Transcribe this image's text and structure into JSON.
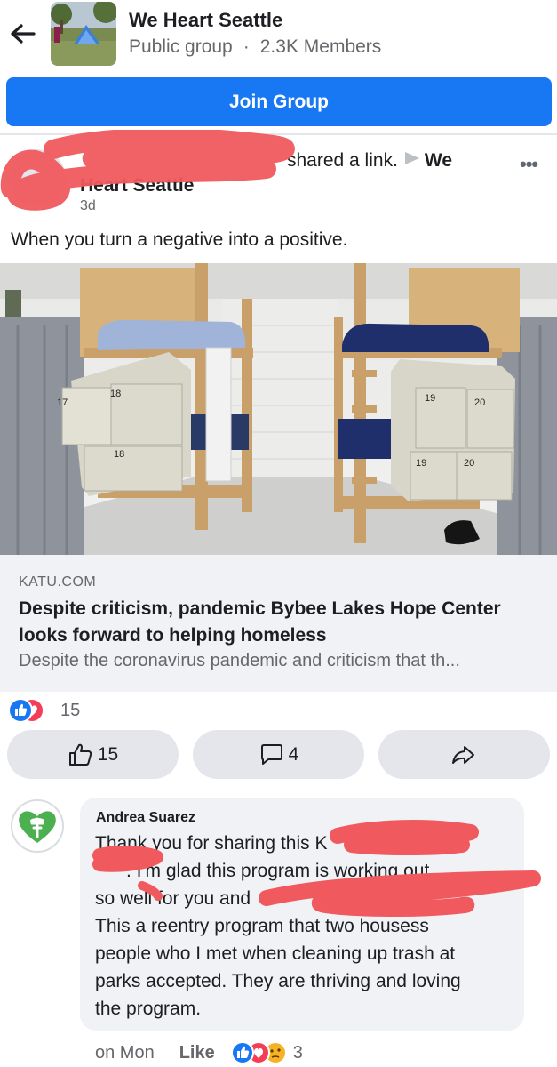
{
  "header": {
    "title": "We Heart Seattle",
    "privacy": "Public group",
    "separator": "·",
    "members": "2.3K Members"
  },
  "join_button": "Join Group",
  "post": {
    "action_text": "shared a link.",
    "group_name_line1": "We",
    "group_name_line2": "Heart Seattle",
    "time": "3d",
    "more_icon": "more-horizontal-icon",
    "text": "When you turn a negative into a positive."
  },
  "link": {
    "domain": "KATU.COM",
    "title": "Despite criticism, pandemic Bybee Lakes Hope Center looks forward to helping homeless",
    "description": "Despite the coronavirus pandemic and criticism that th...",
    "locker_numbers": [
      "17",
      "18",
      "18",
      "19",
      "20",
      "19",
      "20"
    ]
  },
  "reactions": {
    "count": "15",
    "icons": [
      "like-reaction-icon",
      "love-reaction-icon"
    ]
  },
  "actions": {
    "like_count": "15",
    "comment_count": "4",
    "share_icon": "share-icon"
  },
  "comment": {
    "author": "Andrea Suarez",
    "lines": [
      "Thank you for sharing this K",
      "      . I'm glad this program is working out",
      "so well for you and",
      "This a reentry program that two housess",
      "people who I met when cleaning up trash at",
      "parks accepted. They are thriving and loving",
      "the program."
    ],
    "time": "on Mon",
    "like_label": "Like",
    "reaction_count": "3"
  },
  "colors": {
    "brand_blue": "#1877f2",
    "secondary_text": "#65676b",
    "scribble_red": "#f05a5e",
    "bubble_bg": "#f0f2f5"
  }
}
